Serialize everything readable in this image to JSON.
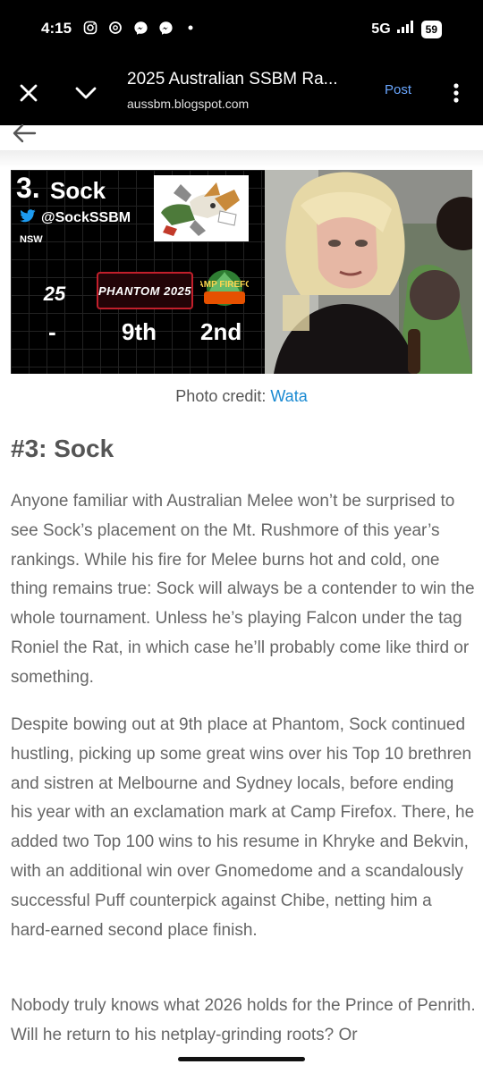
{
  "status_bar": {
    "time": "4:15",
    "network": "5G",
    "battery": "59",
    "icons": [
      "instagram-icon",
      "threads-icon",
      "messenger-icon",
      "messenger-icon",
      "dot-icon"
    ]
  },
  "toolbar": {
    "title": "2025 Australian SSBM Ra...",
    "url": "aussbm.blogspot.com",
    "post_label": "Post"
  },
  "banner": {
    "rank": "3.",
    "name": "Sock",
    "twitter_handle": "@SockSSBM",
    "region": "NSW",
    "event_1_logo": "25",
    "event_2_logo": "PHANTOM 2025",
    "event_3_logo": "CAMP FIREFOX",
    "placings": [
      "-",
      "9th",
      "2nd"
    ]
  },
  "credit": {
    "text": "Photo credit: ",
    "link": "Wata"
  },
  "article": {
    "heading": "#3: Sock",
    "paragraph_1": "Anyone familiar with Australian Melee won’t be surprised to see Sock’s placement on the Mt. Rushmore of this year’s rankings. While his fire for Melee burns hot and cold, one thing remains true: Sock will always be a contender to win the whole tournament. Unless he’s playing Falcon under the tag Roniel the Rat, in which case he’ll probably come like third or something.",
    "paragraph_2": "Despite bowing out at 9th place at Phantom, Sock continued hustling, picking up some great wins over his Top 10 brethren and sistren at Melbourne and Sydney locals, before ending his year with an exclamation mark at Camp Firefox. There, he added two Top 100 wins to his resume in Khryke and Bekvin, with an additional win over Gnomedome and a scandalously successful Puff counterpick against Chibe, netting him a hard-earned second place finish.",
    "paragraph_3": "Nobody truly knows what 2026 holds for the Prince of Penrith. Will he return to his netplay-grinding roots? Or"
  },
  "colors": {
    "accent_link": "#1a8ad2",
    "post_link": "#6aa7ff",
    "twitter_blue": "#1d9bf0",
    "phantom_red": "#c21f2b"
  }
}
